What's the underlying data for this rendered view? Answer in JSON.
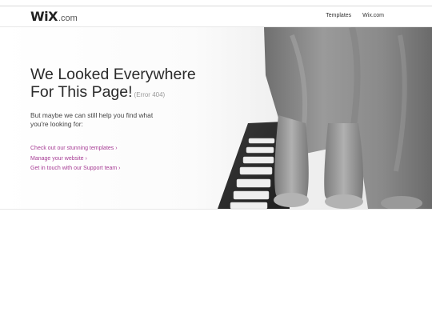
{
  "header": {
    "logo_main": "WiX",
    "logo_suffix": ".com",
    "nav": [
      "Templates",
      "Wix.com"
    ]
  },
  "hero": {
    "headline_line1": "We Looked Everywhere",
    "headline_line2": "For This Page!",
    "error_code": "(Error 404)",
    "subtext": "But maybe we can still help you find what you're looking for:",
    "links": [
      "Check out our stunning templates ›",
      "Manage your website ›",
      "Get in touch with our Support team ›"
    ]
  },
  "colors": {
    "link": "#a63b94",
    "cat": "#8f8f8f"
  },
  "icons": [
    "cat-photo-image",
    "keyboard-image"
  ]
}
